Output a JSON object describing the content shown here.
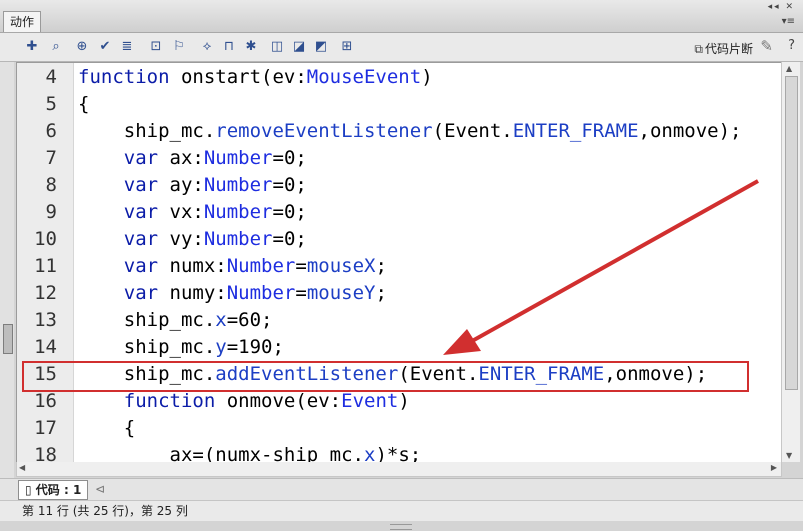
{
  "panel": {
    "tab_title": "动作",
    "window_controls": "◂◂  ✕",
    "menu_glyph": "▾≡"
  },
  "toolbar": {
    "icons": [
      "add-statement-icon",
      "find-icon",
      "target-path-icon",
      "check-syntax-icon",
      "auto-format-icon",
      "code-hint-icon",
      "debug-options-icon",
      "collapse-braces-icon",
      "collapse-selection-icon",
      "expand-all-icon",
      "apply-block-comment-icon",
      "apply-line-comment-icon",
      "remove-comment-icon",
      "toggle-toolbox-icon"
    ],
    "icon_glyphs": [
      "✚",
      "⌕",
      "⊕",
      "✔",
      "≣",
      "⊡",
      "⚐",
      "⟡",
      "⊓",
      "✱",
      "◫",
      "◪",
      "◩",
      "⊞"
    ],
    "code_snippets_label": "代码片断",
    "snippet_icon": "⧉",
    "wand_glyph": "✎",
    "help_glyph": "?"
  },
  "editor": {
    "lines": [
      {
        "n": "4",
        "tokens": [
          {
            "t": "function",
            "c": "kw"
          },
          {
            "t": " onstart(ev:"
          },
          {
            "t": "MouseEvent",
            "c": "ty"
          },
          {
            "t": ")"
          }
        ]
      },
      {
        "n": "5",
        "tokens": [
          {
            "t": "{"
          }
        ]
      },
      {
        "n": "6",
        "tokens": [
          {
            "t": "    ship_mc."
          },
          {
            "t": "removeEventListener",
            "c": "pr"
          },
          {
            "t": "(Event."
          },
          {
            "t": "ENTER_FRAME",
            "c": "pr"
          },
          {
            "t": ",onmove);"
          }
        ]
      },
      {
        "n": "7",
        "tokens": [
          {
            "t": "    "
          },
          {
            "t": "var",
            "c": "kw"
          },
          {
            "t": " ax:"
          },
          {
            "t": "Number",
            "c": "ty"
          },
          {
            "t": "=0;"
          }
        ]
      },
      {
        "n": "8",
        "tokens": [
          {
            "t": "    "
          },
          {
            "t": "var",
            "c": "kw"
          },
          {
            "t": " ay:"
          },
          {
            "t": "Number",
            "c": "ty"
          },
          {
            "t": "=0;"
          }
        ]
      },
      {
        "n": "9",
        "tokens": [
          {
            "t": "    "
          },
          {
            "t": "var",
            "c": "kw"
          },
          {
            "t": " vx:"
          },
          {
            "t": "Number",
            "c": "ty"
          },
          {
            "t": "=0;"
          }
        ]
      },
      {
        "n": "10",
        "tokens": [
          {
            "t": "    "
          },
          {
            "t": "var",
            "c": "kw"
          },
          {
            "t": " vy:"
          },
          {
            "t": "Number",
            "c": "ty"
          },
          {
            "t": "=0;"
          }
        ]
      },
      {
        "n": "11",
        "tokens": [
          {
            "t": "    "
          },
          {
            "t": "var",
            "c": "kw"
          },
          {
            "t": " numx:"
          },
          {
            "t": "Number",
            "c": "ty"
          },
          {
            "t": "="
          },
          {
            "t": "mouseX",
            "c": "pr"
          },
          {
            "t": ";"
          }
        ]
      },
      {
        "n": "12",
        "tokens": [
          {
            "t": "    "
          },
          {
            "t": "var",
            "c": "kw"
          },
          {
            "t": " numy:"
          },
          {
            "t": "Number",
            "c": "ty"
          },
          {
            "t": "="
          },
          {
            "t": "mouseY",
            "c": "pr"
          },
          {
            "t": ";"
          }
        ]
      },
      {
        "n": "13",
        "tokens": [
          {
            "t": "    ship_mc."
          },
          {
            "t": "x",
            "c": "pr"
          },
          {
            "t": "=60;"
          }
        ]
      },
      {
        "n": "14",
        "tokens": [
          {
            "t": "    ship_mc."
          },
          {
            "t": "y",
            "c": "pr"
          },
          {
            "t": "=190;"
          }
        ]
      },
      {
        "n": "15",
        "tokens": [
          {
            "t": "    ship_mc."
          },
          {
            "t": "addEventListener",
            "c": "pr"
          },
          {
            "t": "(Event."
          },
          {
            "t": "ENTER_FRAME",
            "c": "pr"
          },
          {
            "t": ",onmove);"
          }
        ]
      },
      {
        "n": "16",
        "tokens": [
          {
            "t": "    "
          },
          {
            "t": "function",
            "c": "kw"
          },
          {
            "t": " onmove(ev:"
          },
          {
            "t": "Event",
            "c": "ty"
          },
          {
            "t": ")"
          }
        ]
      },
      {
        "n": "17",
        "tokens": [
          {
            "t": "    {"
          }
        ]
      },
      {
        "n": "18",
        "tokens": [
          {
            "t": "        ax=(numx-ship_mc."
          },
          {
            "t": "x",
            "c": "pr"
          },
          {
            "t": ")*s;"
          }
        ]
      }
    ],
    "highlighted_line": "15",
    "annotation_color": "#d12f2f"
  },
  "tabs": {
    "code_tab_label": "代码 : 1",
    "file_icon": "▯",
    "pin_glyph": "⊲"
  },
  "status": {
    "text": "第 11 行 (共 25 行)，第 25 列"
  }
}
